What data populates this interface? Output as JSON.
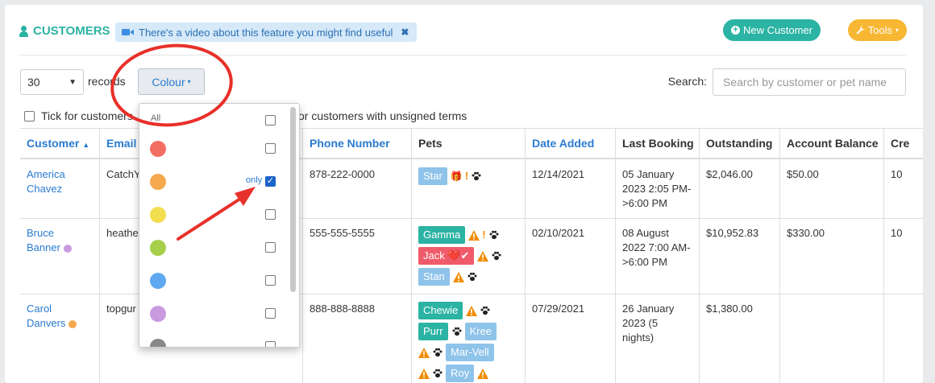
{
  "header": {
    "title": "CUSTOMERS",
    "video_banner": "There's a video about this feature you might find useful",
    "close_glyph": "✖",
    "new_customer_label": "New Customer",
    "tools_label": "Tools",
    "caret": "▾"
  },
  "controls": {
    "records_value": "30",
    "records_label": "records",
    "colour_label": "Colour",
    "search_label": "Search:",
    "search_placeholder": "Search by customer or pet name"
  },
  "filters": {
    "tick_unsigned_partial": "Tick for customers",
    "tick_unsigned_rest": "or customers with unsigned terms"
  },
  "colour_dropdown": {
    "all_label": "All",
    "only_label": "only",
    "items": [
      {
        "color": "#f26e63",
        "checked": false
      },
      {
        "color": "#f5a94f",
        "checked": true
      },
      {
        "color": "#f3de50",
        "checked": false
      },
      {
        "color": "#a7cf4b",
        "checked": false
      },
      {
        "color": "#5ea9ef",
        "checked": false
      },
      {
        "color": "#c89ae0",
        "checked": false
      },
      {
        "color": "#888888",
        "checked": false
      }
    ]
  },
  "table": {
    "columns": [
      "Customer",
      "Email",
      "Phone Number",
      "Pets",
      "Date Added",
      "Last Booking",
      "Outstanding",
      "Account Balance",
      "Cre"
    ],
    "rows": [
      {
        "first": "America",
        "last": "Chavez",
        "dot": "",
        "email": "CatchY",
        "phone": "878-222-0000",
        "date_added": "12/14/2021",
        "last_booking": [
          "05 January",
          "2023 2:05 PM-",
          ">6:00 PM"
        ],
        "outstanding": "$2,046.00",
        "balance": "$50.00",
        "credit": "10"
      },
      {
        "first": "Bruce",
        "last": "Banner",
        "dot": "#c89ae0",
        "email": "heathe",
        "phone": "555-555-5555",
        "date_added": "02/10/2021",
        "last_booking": [
          "08 August",
          "2022 7:00 AM-",
          ">6:00 PM"
        ],
        "outstanding": "$10,952.83",
        "balance": "$330.00",
        "credit": "10"
      },
      {
        "first": "Carol",
        "last": "Danvers",
        "dot": "#f5a94f",
        "email": "topgur",
        "phone": "888-888-8888",
        "date_added": "07/29/2021",
        "last_booking": [
          "26 January",
          "2023 (5",
          "nights)"
        ],
        "outstanding": "$1,380.00",
        "balance": "",
        "credit": ""
      }
    ],
    "pets": {
      "star": "Star",
      "gamma": "Gamma",
      "jack": "Jack",
      "jack_tail": "❤️✔",
      "stan": "Stan",
      "chewie": "Chewie",
      "purr": "Purr",
      "kree": "Kree",
      "marvell": "Mar-Vell",
      "roy": "Roy"
    },
    "pet_colors": {
      "blue": "#8ec3ea",
      "teal": "#2bb3a3",
      "red": "#ef5b6a"
    },
    "icons": {
      "exclaim": "!",
      "gift": "🎁"
    }
  },
  "annotation": {
    "circle_color": "#e8302a",
    "arrow_color": "#e8302a"
  }
}
